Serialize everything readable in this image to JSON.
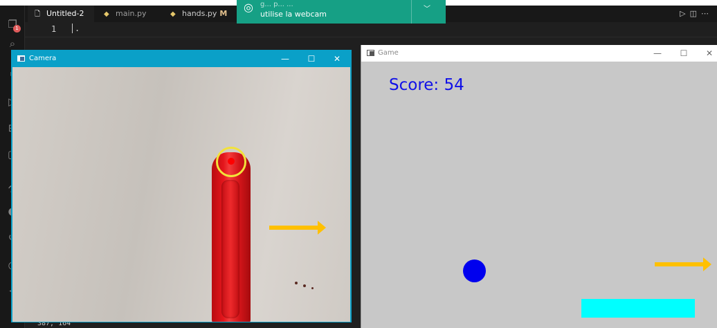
{
  "editor": {
    "tabs": [
      {
        "label": "Untitled-2",
        "icon": "file-icon",
        "active": true
      },
      {
        "label": "main.py",
        "icon": "python-icon",
        "active": false
      },
      {
        "label": "hands.py",
        "icon": "python-icon",
        "active": false,
        "modified": "M"
      }
    ],
    "line_number": "1",
    "line_text": ".",
    "status_text": "387, 164",
    "activity_badge": "1"
  },
  "notification": {
    "line1": "g... p... ...",
    "line2": "utilise la webcam"
  },
  "camera_window": {
    "title": "Camera",
    "minimize": "—",
    "maximize": "☐",
    "close": "✕",
    "colors": {
      "titlebar": "#0aa0c8",
      "tracker": "#f2e23a",
      "marker": "#e4161c"
    }
  },
  "game_window": {
    "title": "Game",
    "minimize": "—",
    "maximize": "☐",
    "close": "✕",
    "score_text": "Score: 54",
    "colors": {
      "background": "#c8c8c8",
      "score": "#1010e8",
      "ball": "#0000ee",
      "paddle": "#00ffff"
    }
  },
  "annotations": {
    "arrow_color": "#ffc000"
  }
}
